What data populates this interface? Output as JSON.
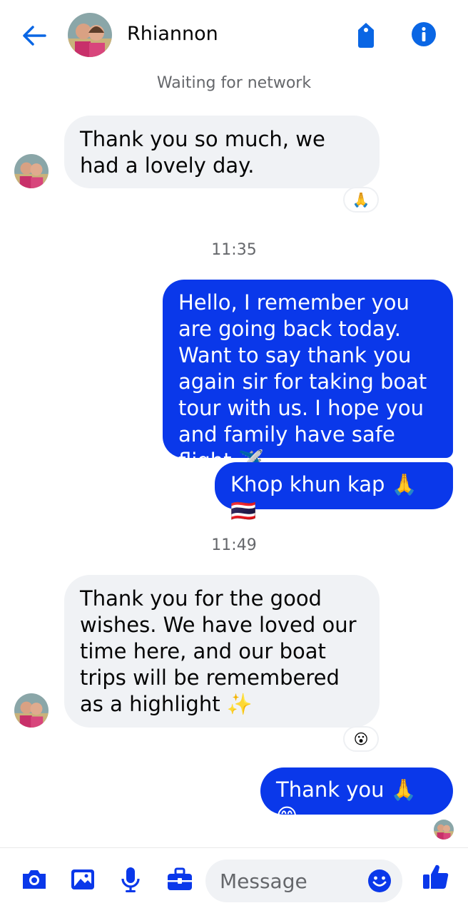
{
  "header": {
    "contact_name": "Rhiannon",
    "accent_color": "#0a66e4"
  },
  "status_text": "Waiting for network",
  "messages": [
    {
      "from": "them",
      "text": "Thank you so much, we had a lovely day.",
      "reaction": "🙏"
    },
    {
      "divider_time": "11:35"
    },
    {
      "from": "me",
      "text": "Hello, I remember you are going back today. Want to say thank you again sir for taking boat tour with us. I hope you and family have safe flight ✈️"
    },
    {
      "from": "me",
      "text": "Khop khun kap 🙏🇹🇭"
    },
    {
      "divider_time": "11:49"
    },
    {
      "from": "them",
      "text": "Thank you for the good wishes. We have loved our time here, and our boat trips will be remembered as a highlight ✨",
      "reaction": "😮"
    },
    {
      "from": "me",
      "text": "Thank you 🙏😊"
    }
  ],
  "composer": {
    "placeholder": "Message",
    "icons": [
      "camera-icon",
      "gallery-icon",
      "microphone-icon",
      "briefcase-icon",
      "emoji-icon",
      "thumbs-up-icon"
    ]
  },
  "colors": {
    "outgoing_bubble": "#0a38ea",
    "incoming_bubble": "#f0f2f5",
    "icon_blue": "#0a38ea"
  }
}
